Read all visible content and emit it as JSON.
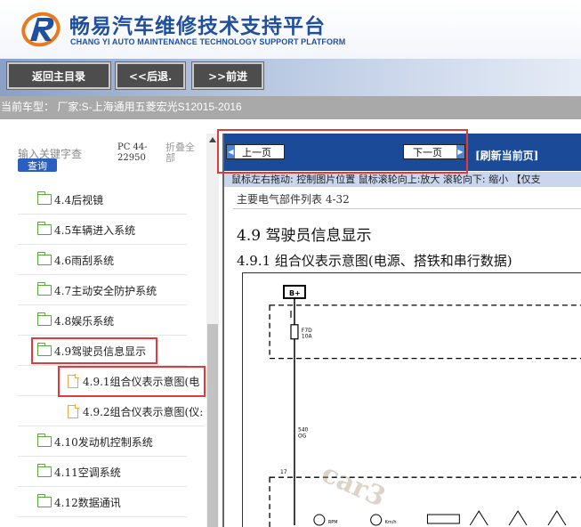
{
  "header": {
    "title": "畅易汽车维修技术支持平台",
    "subtitle": "CHANG YI AUTO MAINTENANCE TECHNOLOGY SUPPORT PLATFORM"
  },
  "toolbar": {
    "home_label": "返回主目录",
    "back_label": "<<后退.",
    "forward_label": ">>前进"
  },
  "model_line": "当前车型： 厂家:S-上海通用五菱宏光S12015-2016",
  "search": {
    "placeholder": "输入关键字查",
    "button_label": "查询",
    "pc_label": "PC 44-22950",
    "fold_label": "折叠全部"
  },
  "tree": {
    "items": [
      {
        "label": "4.4后视镜",
        "type": "folder"
      },
      {
        "label": "4.5车辆进入系统",
        "type": "folder"
      },
      {
        "label": "4.6雨刮系统",
        "type": "folder"
      },
      {
        "label": "4.7主动安全防护系统",
        "type": "folder"
      },
      {
        "label": "4.8娱乐系统",
        "type": "folder"
      },
      {
        "label": "4.9驾驶员信息显示",
        "type": "folder"
      },
      {
        "label": "4.9.1组合仪表示意图(电",
        "type": "file"
      },
      {
        "label": "4.9.2组合仪表示意图(仪:",
        "type": "file"
      },
      {
        "label": "4.10发动机控制系统",
        "type": "folder"
      },
      {
        "label": "4.11空调系统",
        "type": "folder"
      },
      {
        "label": "4.12数据通讯",
        "type": "folder"
      }
    ]
  },
  "viewer": {
    "prev_label": "上一页",
    "next_label": "下一页",
    "refresh_label": "[刷新当前页]",
    "hint": "鼠标左右拖动: 控制图片位置  鼠标滚轮向上:放大  滚轮向下: 缩小 【仅支",
    "doc_subtitle": "主要电气部件列表 4-32",
    "heading1": "4.9 驾驶员信息显示",
    "heading2": "4.9.1 组合仪表示意图(电源、搭铁和串行数据)",
    "diagram": {
      "bplus": "B+",
      "fuse": "F7D\n10A",
      "wire1": "540\nOG",
      "wire2": "17",
      "rpm": "RPM",
      "kmh": "Km/h"
    },
    "watermark": "car3"
  },
  "colors": {
    "brand_blue": "#1f4f9e",
    "nav_blue": "#1b4a98",
    "highlight_red": "#e03a3a",
    "folder_green": "#5aa837",
    "file_orange": "#e8a64b"
  }
}
